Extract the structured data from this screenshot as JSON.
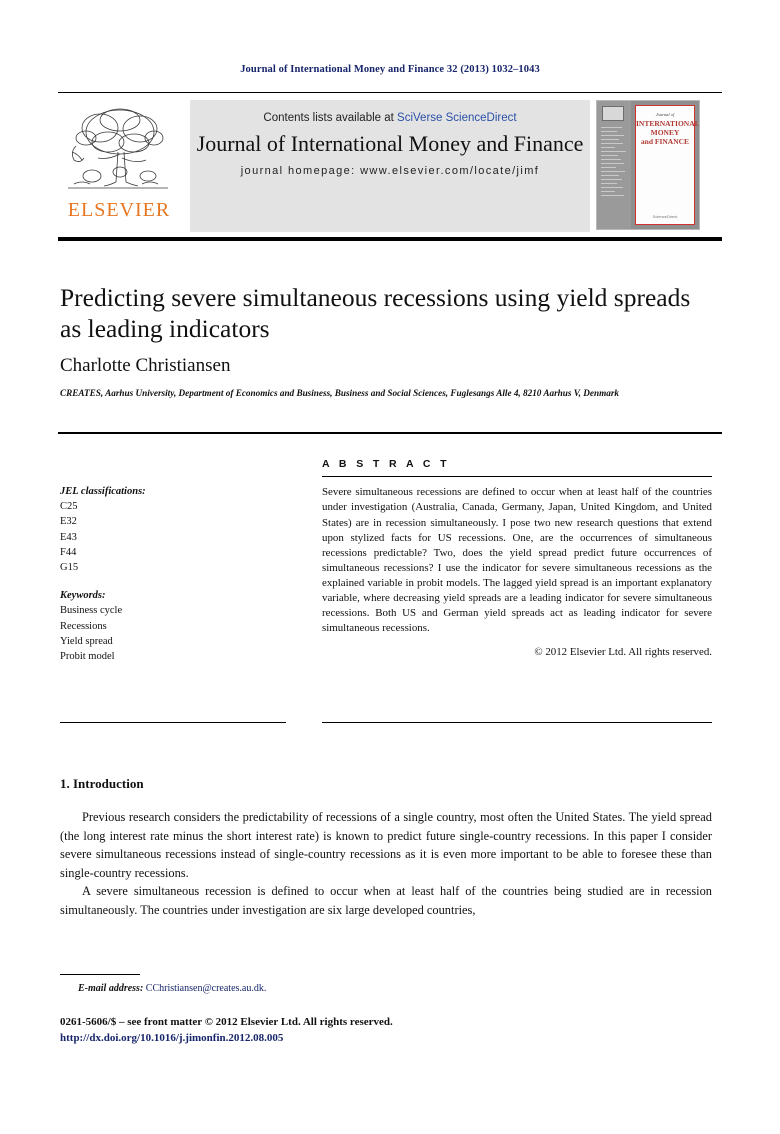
{
  "running_head": "Journal of International Money and Finance 32 (2013) 1032–1043",
  "masthead": {
    "contents_prefix": "Contents lists available at",
    "sciencedirect": "SciVerse ScienceDirect",
    "journal_title": "Journal of International Money and Finance",
    "homepage": "journal homepage: www.elsevier.com/locate/jimf",
    "publisher_name": "ELSEVIER",
    "publisher_color": "#e87722",
    "link_color": "#2b50a8",
    "background": "#e3e3e3"
  },
  "cover": {
    "journal_of": "Journal of",
    "title_line1": "INTERNATIONAL",
    "title_line2": "MONEY",
    "title_line3": "and FINANCE",
    "footer": "ScienceDirect",
    "border_color": "#d0332e"
  },
  "article": {
    "title": "Predicting severe simultaneous recessions using yield spreads as leading indicators",
    "author": "Charlotte Christiansen",
    "affiliation": "CREATES, Aarhus University, Department of Economics and Business, Business and Social Sciences, Fuglesangs Alle 4, 8210 Aarhus V, Denmark"
  },
  "info": {
    "jel_heading": "JEL classifications:",
    "jel_codes": [
      "C25",
      "E32",
      "E43",
      "F44",
      "G15"
    ],
    "keywords_heading": "Keywords:",
    "keywords": [
      "Business cycle",
      "Recessions",
      "Yield spread",
      "Probit model"
    ]
  },
  "abstract": {
    "heading": "A B S T R A C T",
    "body": "Severe simultaneous recessions are defined to occur when at least half of the countries under investigation (Australia, Canada, Germany, Japan, United Kingdom, and United States) are in recession simultaneously. I pose two new research questions that extend upon stylized facts for US recessions. One, are the occurrences of simultaneous recessions predictable? Two, does the yield spread predict future occurrences of simultaneous recessions? I use the indicator for severe simultaneous recessions as the explained variable in probit models. The lagged yield spread is an important explanatory variable, where decreasing yield spreads are a leading indicator for severe simultaneous recessions. Both US and German yield spreads act as leading indicator for severe simultaneous recessions.",
    "copyright": "© 2012 Elsevier Ltd. All rights reserved."
  },
  "section": {
    "heading": "1. Introduction",
    "paragraph1": "Previous research considers the predictability of recessions of a single country, most often the United States. The yield spread (the long interest rate minus the short interest rate) is known to predict future single-country recessions. In this paper I consider severe simultaneous recessions instead of single-country recessions as it is even more important to be able to foresee these than single-country recessions.",
    "paragraph2": "A severe simultaneous recession is defined to occur when at least half of the countries being studied are in recession simultaneously. The countries under investigation are six large developed countries,"
  },
  "footer": {
    "email_label": "E-mail address:",
    "email_address": "CChristiansen@creates.au.dk.",
    "issn_line": "0261-5606/$ – see front matter © 2012 Elsevier Ltd. All rights reserved.",
    "doi": "http://dx.doi.org/10.1016/j.jimonfin.2012.08.005",
    "link_color": "#17256b"
  }
}
